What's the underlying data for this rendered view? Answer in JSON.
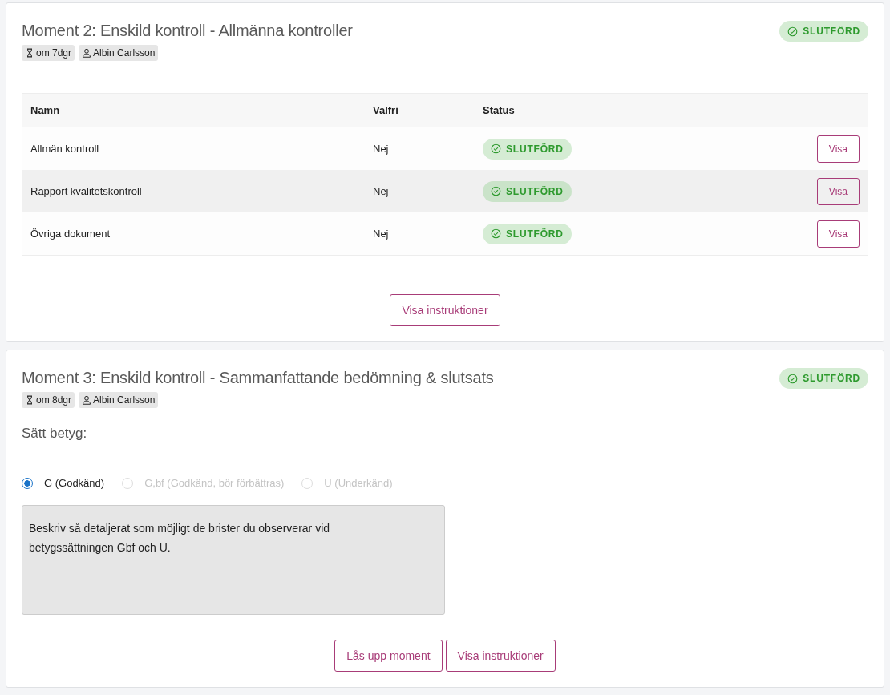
{
  "moments": [
    {
      "title": "Moment 2: Enskild kontroll - Allmänna kontroller",
      "status": {
        "label": "SLUTFÖRD",
        "kind": "done"
      },
      "due": "om 7dgr",
      "assignee": "Albin Carlsson",
      "table": {
        "columns": [
          "Namn",
          "Valfri",
          "Status"
        ],
        "rows": [
          {
            "name": "Allmän kontroll",
            "optional": "Nej",
            "status": {
              "label": "SLUTFÖRD",
              "kind": "done"
            },
            "action": "Visa",
            "highlighted": false
          },
          {
            "name": "Rapport kvalitetskontroll",
            "optional": "Nej",
            "status": {
              "label": "SLUTFÖRD",
              "kind": "done"
            },
            "action": "Visa",
            "highlighted": true
          },
          {
            "name": "Övriga dokument",
            "optional": "Nej",
            "status": {
              "label": "SLUTFÖRD",
              "kind": "done"
            },
            "action": "Visa",
            "highlighted": false
          }
        ]
      },
      "buttons": [
        "Visa instruktioner"
      ]
    },
    {
      "title": "Moment 3: Enskild kontroll - Sammanfattande bedömning & slutsats",
      "status": {
        "label": "SLUTFÖRD",
        "kind": "done"
      },
      "due": "om 8dgr",
      "assignee": "Albin Carlsson",
      "grading": {
        "heading": "Sätt betyg:",
        "options": [
          {
            "label": "G (Godkänd)",
            "selected": true,
            "disabled": false
          },
          {
            "label": "G,bf (Godkänd, bör förbättras)",
            "selected": false,
            "disabled": true
          },
          {
            "label": "U (Underkänd)",
            "selected": false,
            "disabled": true
          }
        ],
        "comment": {
          "value": "Beskriv så detaljerat som möjligt de brister du observerar vid betygssättningen Gbf och U.",
          "disabled": true
        }
      },
      "buttons": [
        "Lås upp moment",
        "Visa instruktioner"
      ]
    }
  ]
}
